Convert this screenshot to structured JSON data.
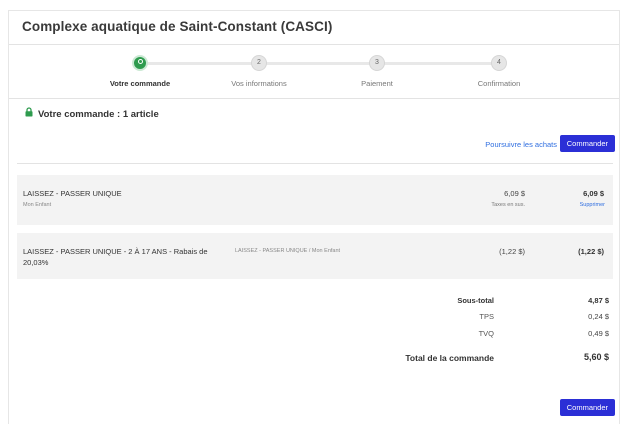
{
  "page": {
    "title": "Complexe aquatique de Saint-Constant (CASCI)"
  },
  "steps": [
    {
      "number": "",
      "label": "Votre commande",
      "active": true
    },
    {
      "number": "2",
      "label": "Vos informations",
      "active": false
    },
    {
      "number": "3",
      "label": "Paiement",
      "active": false
    },
    {
      "number": "4",
      "label": "Confirmation",
      "active": false
    }
  ],
  "order": {
    "heading": "Votre commande : 1 article",
    "continue_link": "Poursuivre les achats",
    "order_button": "Commander"
  },
  "items": [
    {
      "name": "LAISSEZ - PASSER UNIQUE",
      "sub": "Mon Enfant",
      "price": "6,09 $",
      "tax_note": "Taxes en sus.",
      "total": "6,09 $",
      "remove": "Supprimer"
    },
    {
      "name": "LAISSEZ - PASSER UNIQUE - 2 À 17 ANS - Rabais de 20,03%",
      "variant": "LAISSEZ - PASSER UNIQUE / Mon Enfant",
      "price": "(1,22 $)",
      "total": "(1,22 $)"
    }
  ],
  "summary": {
    "subtotal_label": "Sous-total",
    "subtotal_value": "4,87 $",
    "tps_label": "TPS",
    "tps_value": "0,24 $",
    "tvq_label": "TVQ",
    "tvq_value": "0,49 $",
    "total_label": "Total de la commande",
    "total_value": "5,60 $"
  },
  "colors": {
    "accent_green": "#2e9b4e",
    "button_blue": "#2b2fd6",
    "link_blue": "#2f6ee0"
  },
  "icons": {
    "lock": "lock-icon"
  }
}
